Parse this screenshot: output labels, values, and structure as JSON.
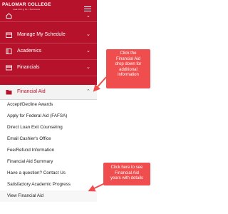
{
  "header": {
    "logo_text": "PALOMAR COLLEGE",
    "logo_sub": "Learning for Success",
    "colors": {
      "brand": "#b7122b",
      "callout": "#f04e4e"
    }
  },
  "nav": {
    "items": [
      {
        "label": "Manage My Schedule",
        "icon": "calendar-icon"
      },
      {
        "label": "Academics",
        "icon": "book-icon"
      },
      {
        "label": "Financials",
        "icon": "card-icon"
      }
    ]
  },
  "financial_aid": {
    "label": "Financial Aid",
    "icon": "folder-icon",
    "expanded": true,
    "items": [
      "Accept/Decline Awards",
      "Apply for Federal Aid (FAFSA)",
      "Direct Loan Exit Counseling",
      "Email Cashier's Office",
      "Fee/Refund Information",
      "Financial Aid Summary",
      "Have a question? Contact Us",
      "Satisfactory Academic Progress",
      "View Financial Aid"
    ]
  },
  "callouts": {
    "dropdown": [
      "Click the",
      "Financial Aid",
      "drop down for",
      "additional",
      "information"
    ],
    "years": [
      "Click here to see",
      "Financial Aid",
      "years with details"
    ]
  }
}
